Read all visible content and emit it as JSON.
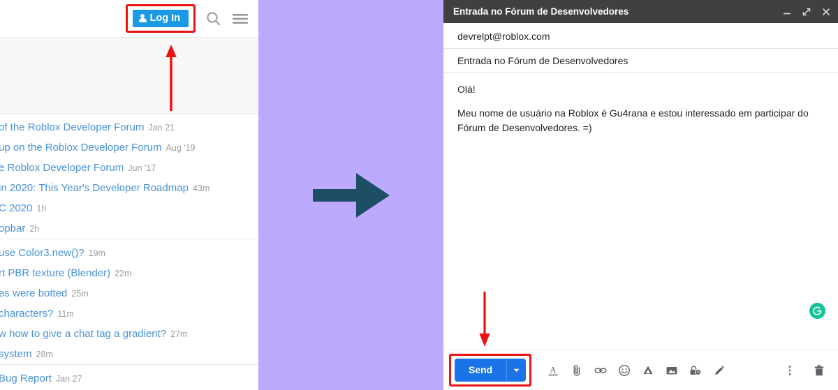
{
  "forum": {
    "login_label": "Log In",
    "login_icon": "user-icon",
    "search_icon": "search-icon",
    "menu_icon": "hamburger-menu-icon",
    "topic_groups": [
      {
        "topics": [
          {
            "title": "of the Roblox Developer Forum",
            "time": "Jan 21"
          },
          {
            "title": "up on the Roblox Developer Forum",
            "time": "Aug '19"
          },
          {
            "title": "e Roblox Developer Forum",
            "time": "Jun '17"
          },
          {
            "title": "in 2020: This Year's Developer Roadmap",
            "time": "43m"
          },
          {
            "title": "C 2020",
            "time": "1h"
          },
          {
            "title": "opbar",
            "time": "2h"
          }
        ]
      },
      {
        "topics": [
          {
            "title": "use Color3.new()?",
            "time": "19m"
          },
          {
            "title": "rt PBR texture (Blender)",
            "time": "22m"
          },
          {
            "title": "es were botted",
            "time": "25m"
          },
          {
            "title": "characters?",
            "time": "11m"
          },
          {
            "title": "w how to give a chat tag a gradient?",
            "time": "27m"
          },
          {
            "title": "system",
            "time": "28m"
          }
        ]
      },
      {
        "topics": [
          {
            "title": "Bug Report",
            "time": "Jan 27"
          }
        ]
      }
    ]
  },
  "middle": {
    "arrow_icon": "right-arrow-icon",
    "background_color": "#bdaaff",
    "arrow_color": "#1c4f63"
  },
  "annotations": {
    "color": "#ee1111",
    "up_arrow_icon": "annotation-up-arrow-icon",
    "down_arrow_icon": "annotation-down-arrow-icon",
    "login_highlight": "login-button-highlight",
    "send_highlight": "send-button-highlight"
  },
  "compose": {
    "title": "Entrada no Fórum de Desenvolvedores",
    "minimize_icon": "minimize-icon",
    "expand_icon": "expand-icon",
    "close_icon": "close-icon",
    "to": "devrelpt@roblox.com",
    "subject": "Entrada no Fórum de Desenvolvedores",
    "body": [
      "Olá!",
      "Meu nome de usuário na Roblox é Gu4rana e estou interessado em participar do Fórum de Desenvolvedores. =)"
    ],
    "grammarly_icon": "grammarly-icon",
    "toolbar": {
      "send_label": "Send",
      "send_caret_icon": "chevron-down-icon",
      "icons": [
        "format-text-icon",
        "attach-file-icon",
        "insert-link-icon",
        "insert-emoji-icon",
        "insert-drive-file-icon",
        "insert-photo-icon",
        "confidential-mode-icon",
        "insert-signature-icon"
      ],
      "more_options_icon": "more-options-icon",
      "discard_icon": "trash-icon"
    },
    "colors": {
      "header_bg": "#404040",
      "send_blue": "#1a73e8",
      "grammarly_green": "#15c39a"
    }
  }
}
